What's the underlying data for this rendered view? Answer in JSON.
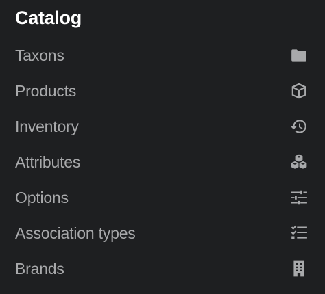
{
  "menu": {
    "title": "Catalog",
    "items": [
      {
        "label": "Taxons",
        "icon": "folder-icon"
      },
      {
        "label": "Products",
        "icon": "cube-icon"
      },
      {
        "label": "Inventory",
        "icon": "history-icon"
      },
      {
        "label": "Attributes",
        "icon": "cubes-icon"
      },
      {
        "label": "Options",
        "icon": "sliders-icon"
      },
      {
        "label": "Association types",
        "icon": "tasks-list-icon"
      },
      {
        "label": "Brands",
        "icon": "building-icon"
      }
    ]
  },
  "colors": {
    "background": "#1e1f21",
    "title": "#ffffff",
    "item_text": "#a8a9ab",
    "icon": "#a8a9ab"
  }
}
